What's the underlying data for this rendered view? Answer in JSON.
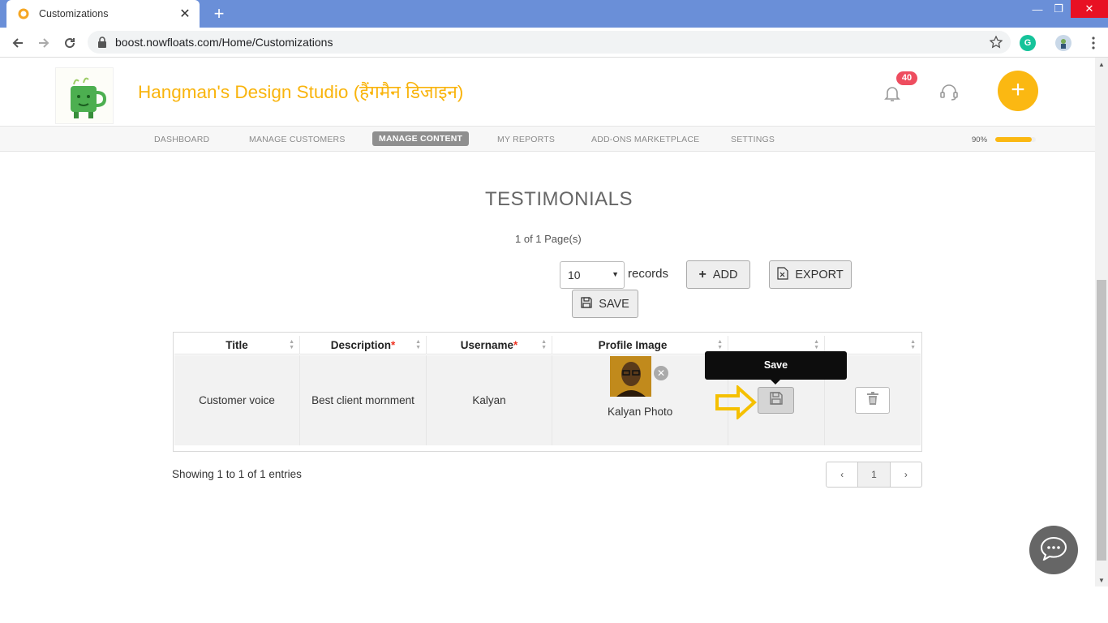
{
  "browser": {
    "tab_title": "Customizations",
    "url": "boost.nowfloats.com/Home/Customizations"
  },
  "header": {
    "brand": "Hangman's Design Studio (हैंगमैन डिजाइन)",
    "notification_count": "40"
  },
  "menu": {
    "items": [
      "DASHBOARD",
      "MANAGE CUSTOMERS",
      "MANAGE CONTENT",
      "MY REPORTS",
      "ADD-ONS MARKETPLACE",
      "SETTINGS"
    ],
    "active": "MANAGE CONTENT",
    "progress_label": "90%",
    "progress_value": 0.9
  },
  "main": {
    "title": "TESTIMONIALS",
    "page_info": "1 of 1 Page(s)",
    "records_value": "10",
    "records_label": "records",
    "add_label": "ADD",
    "export_label": "EXPORT",
    "save_label": "SAVE"
  },
  "table": {
    "headers": [
      "Title",
      "Description",
      "Username",
      "Profile Image",
      "",
      ""
    ],
    "required": [
      "Description",
      "Username"
    ],
    "row": {
      "title": "Customer voice",
      "description": "Best client mornment",
      "username": "Kalyan",
      "photo_caption": "Kalyan Photo"
    },
    "tooltip": "Save"
  },
  "footer": {
    "showing": "Showing 1 to 1 of 1 entries",
    "prev": "‹",
    "page": "1",
    "next": "›"
  },
  "colors": {
    "brand": "#f9b40d",
    "tabbar": "#6a8fd8",
    "badge": "#ee4d5f"
  }
}
